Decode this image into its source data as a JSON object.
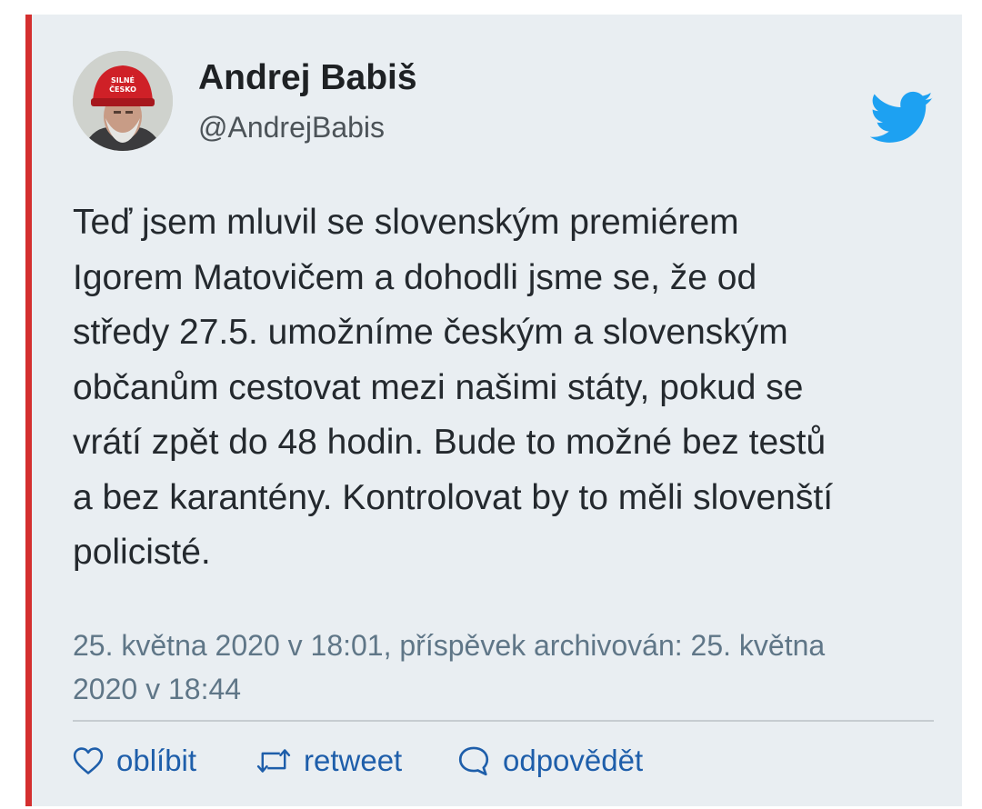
{
  "author": {
    "name": "Andrej Babiš",
    "handle": "@AndrejBabis",
    "cap_text": [
      "SILNÉ",
      "ČESKO"
    ]
  },
  "tweet": {
    "lines": [
      "Teď jsem mluvil se slovenským premiérem",
      "Igorem Matovičem a dohodli jsme se, že od",
      "středy 27.5. umožníme českým a slovenským",
      "občanům cestovat mezi našimi státy, pokud se",
      "vrátí zpět do 48 hodin. Bude to možné bez testů",
      "a bez karantény. Kontrolovat by to měli slovenští",
      "policisté."
    ]
  },
  "meta": {
    "lines": [
      "25. května 2020 v 18:01, příspěvek archivován: 25. května",
      "2020 v 18:44"
    ]
  },
  "actions": {
    "like_label": "oblíbit",
    "retweet_label": "retweet",
    "reply_label": "odpovědět"
  },
  "icons": {
    "brand": "twitter-bird-icon",
    "like": "heart-icon",
    "retweet": "retweet-icon",
    "reply": "reply-bubble-icon"
  },
  "colors": {
    "accent_border": "#d42f2f",
    "card_bg": "#e9eef2",
    "twitter_blue": "#1da1f2",
    "action_blue": "#1e5eaa",
    "meta_gray": "#5f7687"
  }
}
